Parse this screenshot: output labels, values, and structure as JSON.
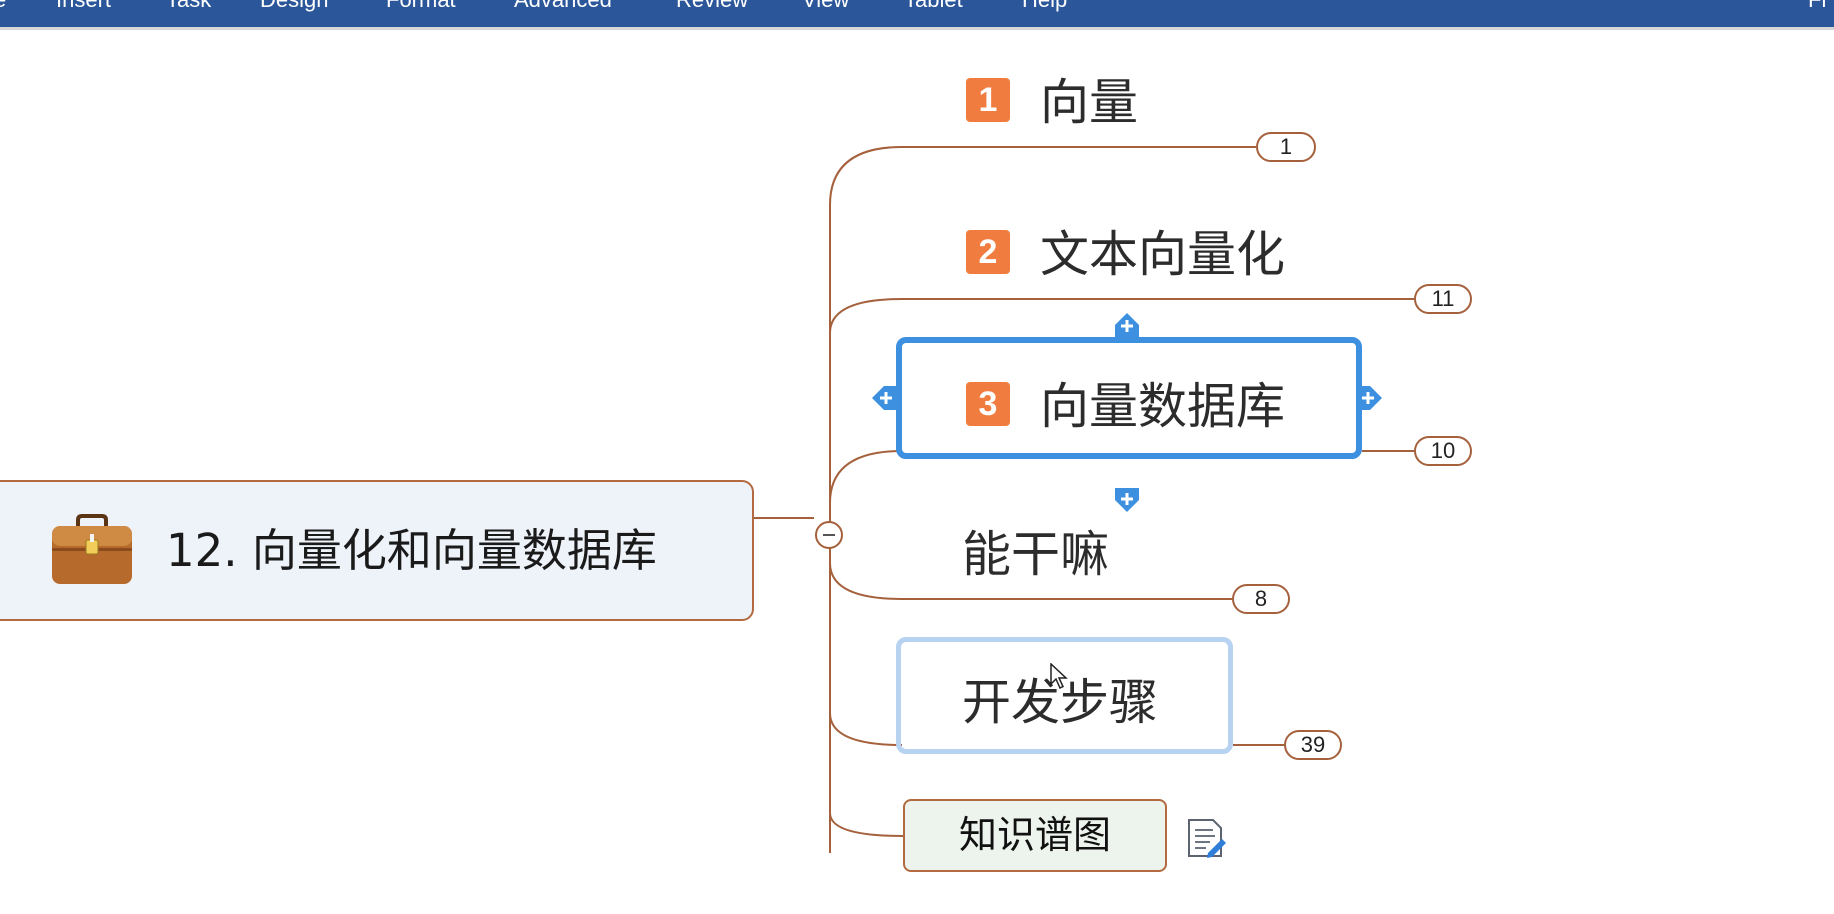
{
  "menubar": {
    "items": [
      "e",
      "Insert",
      "Task",
      "Design",
      "Format",
      "Advanced",
      "Review",
      "View",
      "Tablet",
      "Help"
    ],
    "right_text": "Fi",
    "background": "#2b579a"
  },
  "mindmap": {
    "central": {
      "title": "12. 向量化和向量数据库",
      "icon": "briefcase-icon"
    },
    "topics": [
      {
        "priority": "1",
        "label": "向量",
        "count": "1"
      },
      {
        "priority": "2",
        "label": "文本向量化",
        "count": "11"
      },
      {
        "priority": "3",
        "label": "向量数据库",
        "count": "10",
        "selected": true
      },
      {
        "label": "能干嘛",
        "count": "8"
      },
      {
        "label": "开发步骤",
        "count": "39",
        "hovered": true
      },
      {
        "label": "知识谱图",
        "note": "note-icon"
      }
    ],
    "colors": {
      "branch": "#a5603c",
      "priority_fill": "#f07c40",
      "selection": "#3d8fe0",
      "central_fill": "#eef3fa"
    }
  }
}
